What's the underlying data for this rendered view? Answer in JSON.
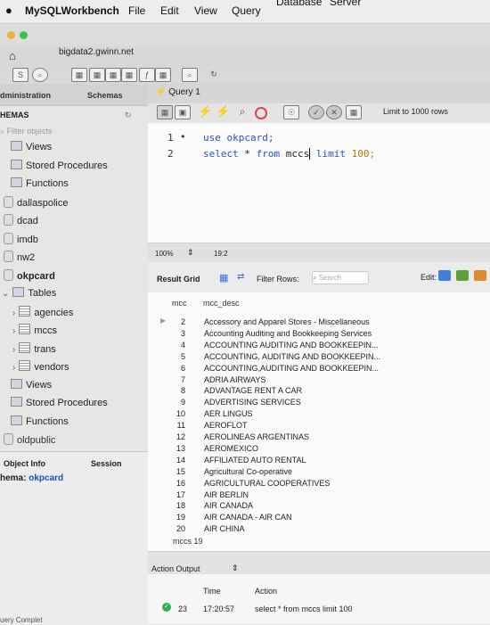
{
  "menubar": {
    "app_name": "MySQLWorkbench",
    "items": [
      "File",
      "Edit",
      "View",
      "Query",
      "Database",
      "Server"
    ]
  },
  "connection": {
    "host": "bigdata2.gwinn.net"
  },
  "sidebar": {
    "tab_admin": "dministration",
    "tab_schemas": "Schemas",
    "header": "HEMAS",
    "filter_placeholder": "Filter objects",
    "items": [
      {
        "label": "Views",
        "kind": "folder",
        "indent": 1
      },
      {
        "label": "Stored Procedures",
        "kind": "folder",
        "indent": 1
      },
      {
        "label": "Functions",
        "kind": "folder",
        "indent": 1
      },
      {
        "label": "dallaspolice",
        "kind": "db",
        "indent": 0
      },
      {
        "label": "dcad",
        "kind": "db",
        "indent": 0
      },
      {
        "label": "imdb",
        "kind": "db",
        "indent": 0
      },
      {
        "label": "nw2",
        "kind": "db",
        "indent": 0
      },
      {
        "label": "okpcard",
        "kind": "db-bold",
        "indent": 0
      },
      {
        "label": "Tables",
        "kind": "folder-open",
        "indent": 1
      },
      {
        "label": "agencies",
        "kind": "table",
        "indent": 2
      },
      {
        "label": "mccs",
        "kind": "table",
        "indent": 2
      },
      {
        "label": "trans",
        "kind": "table",
        "indent": 2
      },
      {
        "label": "vendors",
        "kind": "table",
        "indent": 2
      },
      {
        "label": "Views",
        "kind": "folder",
        "indent": 1
      },
      {
        "label": "Stored Procedures",
        "kind": "folder",
        "indent": 1
      },
      {
        "label": "Functions",
        "kind": "folder",
        "indent": 1
      },
      {
        "label": "oldpublic",
        "kind": "db",
        "indent": 0
      }
    ],
    "info_tab_object": "Object Info",
    "info_tab_session": "Session",
    "schema_label": "hema:",
    "schema_value": "okpcard",
    "bottom_label": "uery Complet"
  },
  "editor": {
    "tab_label": "Query 1",
    "limit_label": "Limit to 1000 rows",
    "lines": [
      {
        "num": "1",
        "marker": "•",
        "code": "use okpcard;"
      },
      {
        "num": "2",
        "marker": "",
        "code_kw": "select",
        "code_rest1": " * ",
        "code_from": "from",
        "code_rest2": " mccs",
        "code_limit": "limit",
        "code_num": "100;"
      }
    ],
    "zoom": "100%",
    "cursor_pos": "19:2"
  },
  "result": {
    "title": "Result Grid",
    "filter_label": "Filter Rows:",
    "search_placeholder": "Search",
    "edit_label": "Edit:",
    "columns": [
      "mcc",
      "mcc_desc"
    ],
    "rows": [
      {
        "mcc": "2",
        "desc": "Accessory and Apparel Stores - Miscellaneous"
      },
      {
        "mcc": "3",
        "desc": "Accounting Auditing and Bookkeeping Services"
      },
      {
        "mcc": "4",
        "desc": "ACCOUNTING AUDITING AND BOOKKEEPIN..."
      },
      {
        "mcc": "5",
        "desc": "ACCOUNTING, AUDITING AND BOOKKEEPIN..."
      },
      {
        "mcc": "6",
        "desc": "ACCOUNTING,AUDITING AND BOOKKEEPIN..."
      },
      {
        "mcc": "7",
        "desc": "ADRIA AIRWAYS"
      },
      {
        "mcc": "8",
        "desc": "ADVANTAGE RENT A CAR"
      },
      {
        "mcc": "9",
        "desc": "ADVERTISING SERVICES"
      },
      {
        "mcc": "10",
        "desc": "AER LINGUS"
      },
      {
        "mcc": "11",
        "desc": "AEROFLOT"
      },
      {
        "mcc": "12",
        "desc": "AEROLINEAS ARGENTINAS"
      },
      {
        "mcc": "13",
        "desc": "AEROMEXICO"
      },
      {
        "mcc": "14",
        "desc": "AFFILIATED AUTO RENTAL"
      },
      {
        "mcc": "15",
        "desc": "Agricultural Co-operative"
      },
      {
        "mcc": "16",
        "desc": "AGRICULTURAL COOPERATIVES"
      },
      {
        "mcc": "17",
        "desc": "AIR BERLIN"
      },
      {
        "mcc": "18",
        "desc": "AIR CANADA"
      },
      {
        "mcc": "19",
        "desc": "AIR CANADA - AIR CAN"
      },
      {
        "mcc": "20",
        "desc": "AIR CHINA"
      }
    ],
    "tab_label": "mccs 19"
  },
  "action": {
    "title": "Action Output",
    "col_time": "Time",
    "col_action": "Action",
    "row_num": "23",
    "row_time": "17:20:57",
    "row_action": "select * from mccs limit 100"
  },
  "colors": {
    "keyword": "#2a52be",
    "number": "#b07a00",
    "ok_green": "#2eae4f",
    "schema_blue": "#1b4fbf"
  }
}
